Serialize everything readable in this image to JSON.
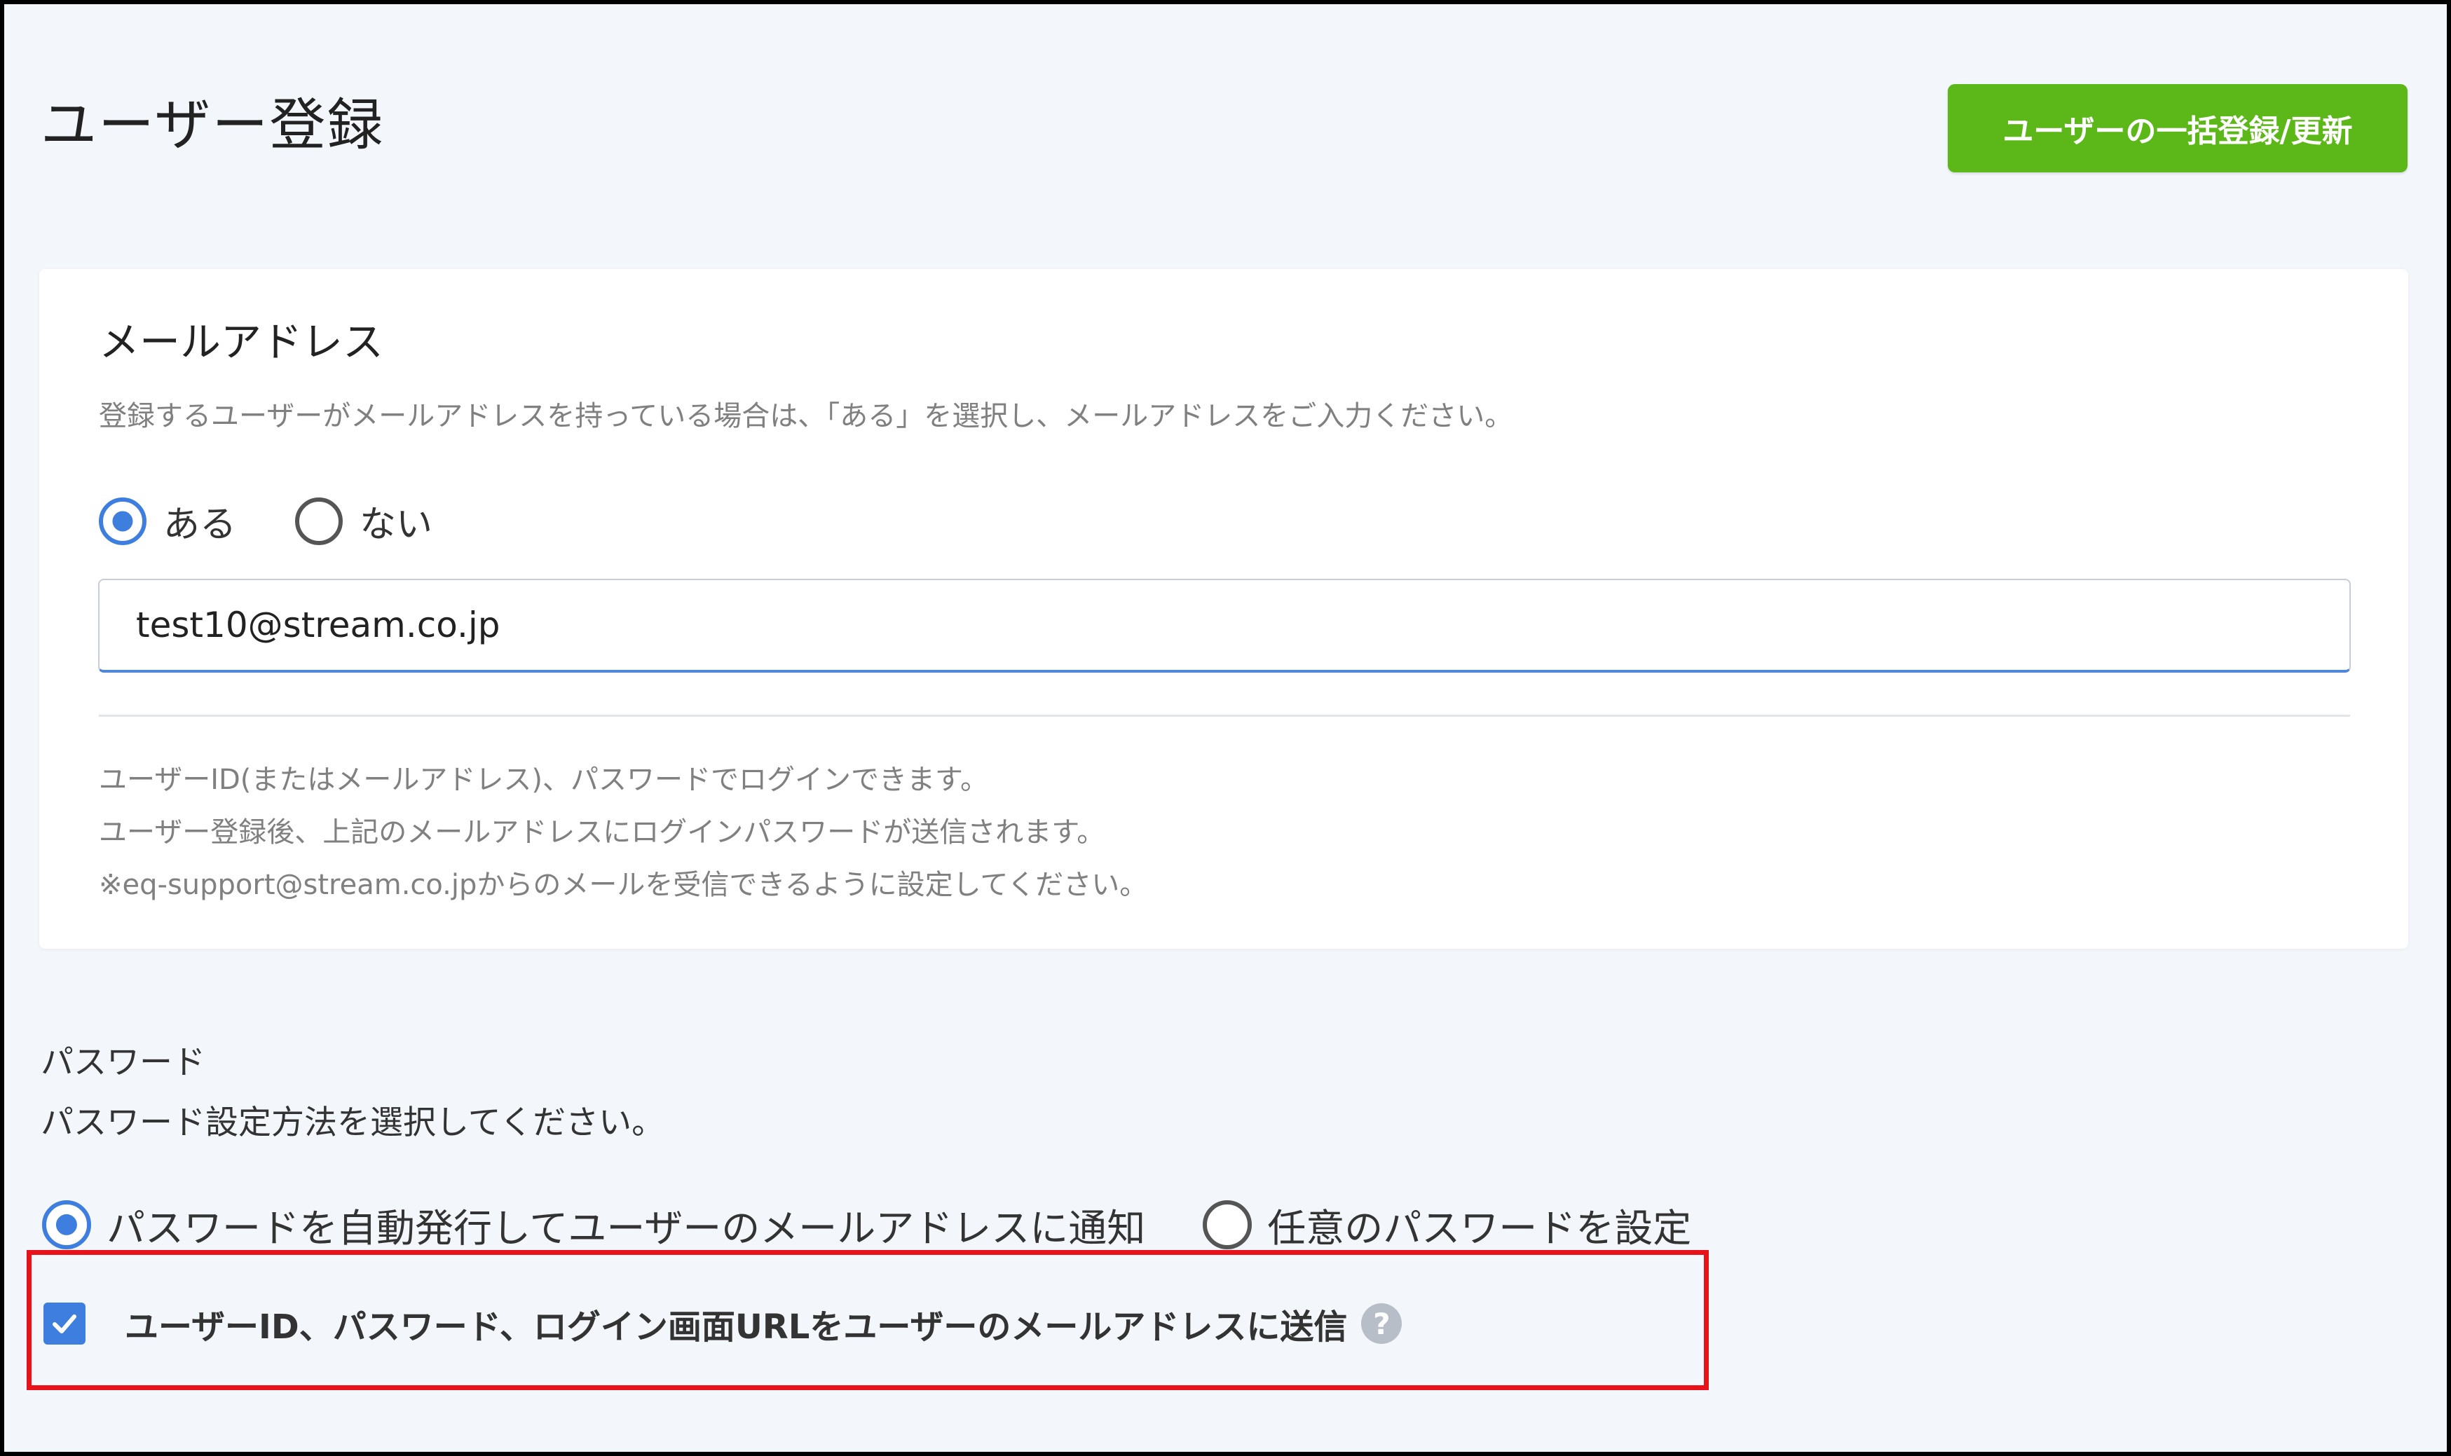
{
  "header": {
    "title": "ユーザー登録",
    "bulk_button_label": "ユーザーの一括登録/更新"
  },
  "email_section": {
    "title": "メールアドレス",
    "description": "登録するユーザーがメールアドレスを持っている場合は、「ある」を選択し、メールアドレスをご入力ください。",
    "options": [
      {
        "label": "ある",
        "selected": true
      },
      {
        "label": "ない",
        "selected": false
      }
    ],
    "input_value": "test10@stream.co.jp",
    "notes": [
      "ユーザーID(またはメールアドレス)、パスワードでログインできます。",
      "ユーザー登録後、上記のメールアドレスにログインパスワードが送信されます。",
      "※eq-support@stream.co.jpからのメールを受信できるように設定してください。"
    ]
  },
  "password_section": {
    "title": "パスワード",
    "description": "パスワード設定方法を選択してください。",
    "options": [
      {
        "label": "パスワードを自動発行してユーザーのメールアドレスに通知",
        "selected": true
      },
      {
        "label": "任意のパスワードを設定",
        "selected": false
      }
    ],
    "send_checkbox": {
      "label": "ユーザーID、パスワード、ログイン画面URLをユーザーのメールアドレスに送信",
      "checked": true,
      "help_icon": "question-circle-icon",
      "help_glyph": "?"
    }
  },
  "colors": {
    "accent_blue": "#3d7ede",
    "button_green": "#5cb818",
    "highlight_red": "#e8121b",
    "page_background": "#f3f6fa"
  }
}
